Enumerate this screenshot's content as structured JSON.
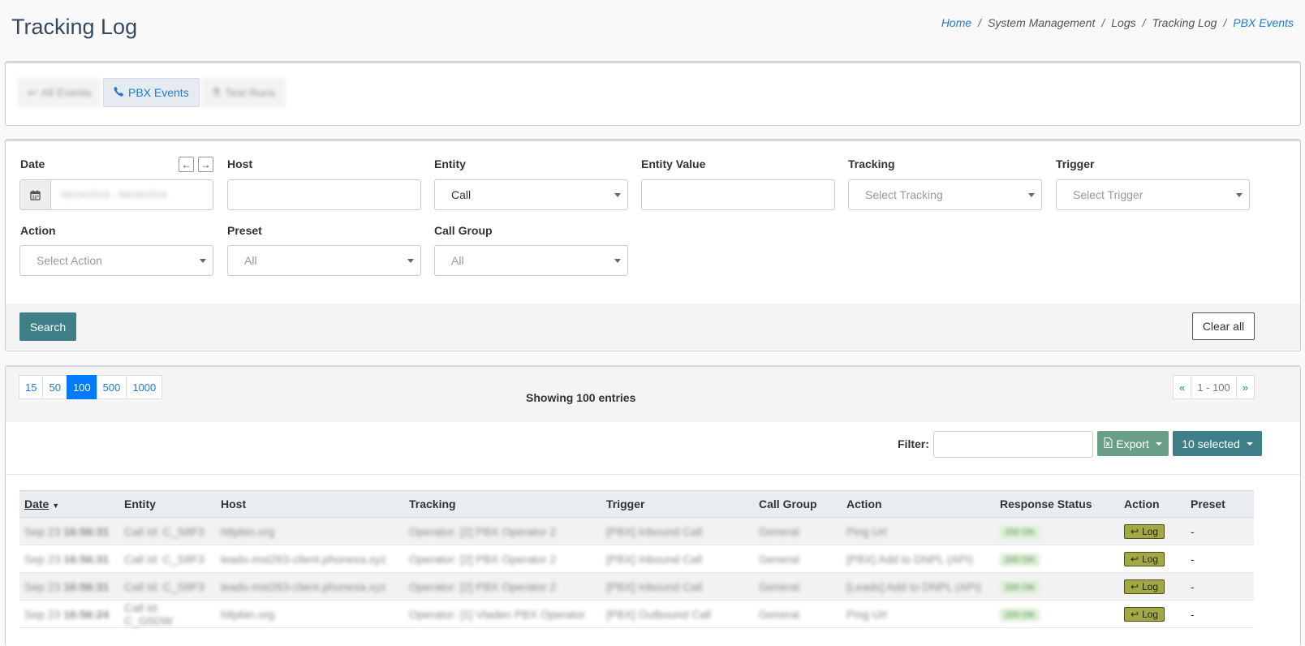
{
  "page": {
    "title": "Tracking Log"
  },
  "breadcrumb": [
    "Home",
    "System Management",
    "Logs",
    "Tracking Log",
    "PBX Events"
  ],
  "tabs": [
    {
      "label": "All Events",
      "icon": "reply-icon"
    },
    {
      "label": "PBX Events",
      "icon": "phone-icon"
    },
    {
      "label": "Test Runs",
      "icon": "flask-icon"
    }
  ],
  "filters": {
    "date": {
      "label": "Date",
      "value": "09/24/2023 - 09/28/2024"
    },
    "host": {
      "label": "Host",
      "value": ""
    },
    "entity": {
      "label": "Entity",
      "value": "Call"
    },
    "entity_value": {
      "label": "Entity Value",
      "value": ""
    },
    "tracking": {
      "label": "Tracking",
      "placeholder": "Select Tracking"
    },
    "trigger": {
      "label": "Trigger",
      "placeholder": "Select Trigger"
    },
    "action": {
      "label": "Action",
      "placeholder": "Select Action"
    },
    "preset": {
      "label": "Preset",
      "value": "All"
    },
    "call_group": {
      "label": "Call Group",
      "value": "All"
    },
    "search_label": "Search",
    "clear_label": "Clear all"
  },
  "results": {
    "page_sizes": [
      "15",
      "50",
      "100",
      "500",
      "1000"
    ],
    "active_page_size": "100",
    "showing": "Showing 100 entries",
    "pager": {
      "prev": "«",
      "range": "1 - 100",
      "next": "»"
    },
    "filter_label": "Filter:",
    "export_label": "Export",
    "selected_label": "10 selected"
  },
  "table": {
    "headers": [
      "Date",
      "Entity",
      "Host",
      "Tracking",
      "Trigger",
      "Call Group",
      "Action",
      "Response Status",
      "Action",
      "Preset"
    ],
    "rows": [
      {
        "date_md": "Sep 23",
        "time": "16:56:31",
        "entity": "Call Id: C_S8F3",
        "host": "httpbin.org",
        "tracking": "Operator: [2] PBX Operator 2",
        "trigger": "[PBX] Inbound Call",
        "group": "General",
        "action": "Ping Url",
        "status": "200 OK",
        "log": "Log",
        "preset": "-"
      },
      {
        "date_md": "Sep 23",
        "time": "16:56:31",
        "entity": "Call Id: C_S8F3",
        "host": "leads-mst263-client.phonexa.xyz",
        "tracking": "Operator: [2] PBX Operator 2",
        "trigger": "[PBX] Inbound Call",
        "group": "General",
        "action": "[PBX] Add to DNPL (API)",
        "status": "200 OK",
        "log": "Log",
        "preset": "-"
      },
      {
        "date_md": "Sep 23",
        "time": "16:56:31",
        "entity": "Call Id: C_S8F3",
        "host": "leads-mst263-client.phonexa.xyz",
        "tracking": "Operator: [2] PBX Operator 2",
        "trigger": "[PBX] Inbound Call",
        "group": "General",
        "action": "[Leads] Add to DNPL (API)",
        "status": "200 OK",
        "log": "Log",
        "preset": "-"
      },
      {
        "date_md": "Sep 23",
        "time": "16:56:24",
        "entity": "Call Id: C_G5DW",
        "host": "httpbin.org",
        "tracking": "Operator: [1] Vladen PBX Operator",
        "trigger": "[PBX] Outbound Call",
        "group": "General",
        "action": "Ping Url",
        "status": "200 OK",
        "log": "Log",
        "preset": "-"
      }
    ]
  },
  "colors": {
    "accent_teal": "#3f7f87",
    "export_green": "#6a9e87",
    "link_blue": "#1e7bd6",
    "log_button": "#a2a843"
  }
}
